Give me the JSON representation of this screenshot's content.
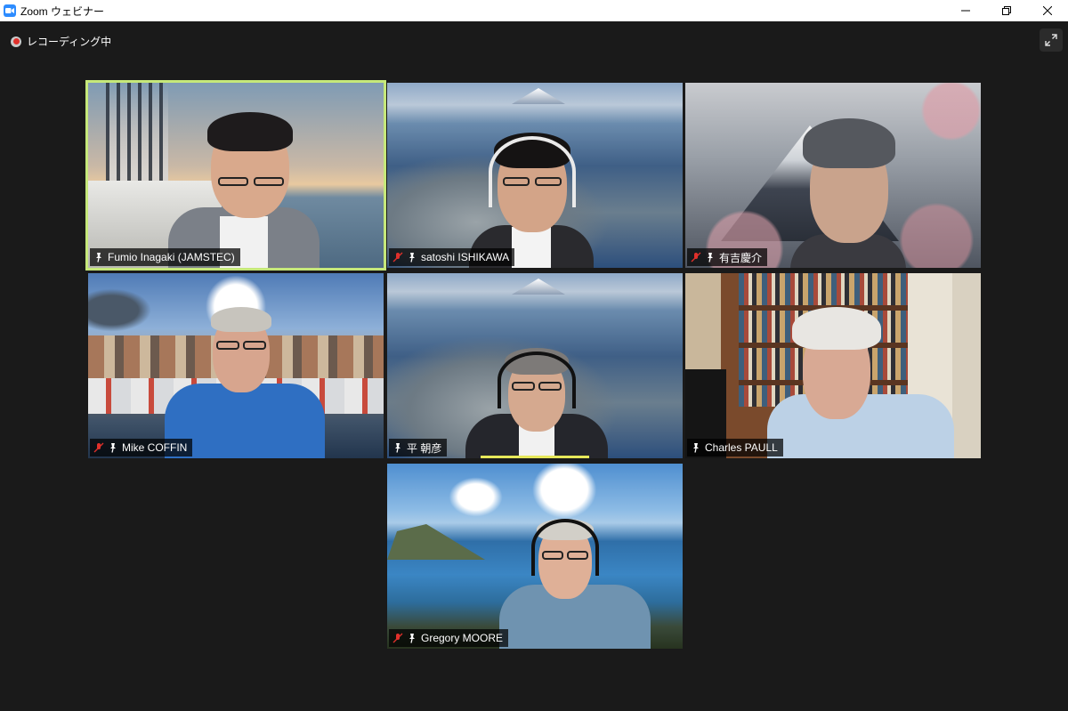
{
  "window": {
    "title": "Zoom ウェビナー"
  },
  "recording": {
    "label": "レコーディング中"
  },
  "participants": [
    {
      "name": "Fumio Inagaki (JAMSTEC)",
      "muted": false,
      "active_speaker": true
    },
    {
      "name": "satoshi ISHIKAWA",
      "muted": true
    },
    {
      "name": "有吉慶介",
      "muted": true
    },
    {
      "name": "Mike COFFIN",
      "muted": true
    },
    {
      "name": "平 朝彦",
      "muted": false,
      "speaking": true
    },
    {
      "name": "Charles PAULL",
      "muted": false
    },
    {
      "name": "Gregory MOORE",
      "muted": true
    }
  ],
  "colors": {
    "active_border": "#c6e87a",
    "mute_icon": "#e0302b",
    "record_dot": "#e0302b",
    "zoom_brand": "#2d8cff"
  },
  "icons": {
    "pin": "pin-icon",
    "muted": "muted-mic-icon",
    "fullscreen": "fullscreen-icon"
  }
}
